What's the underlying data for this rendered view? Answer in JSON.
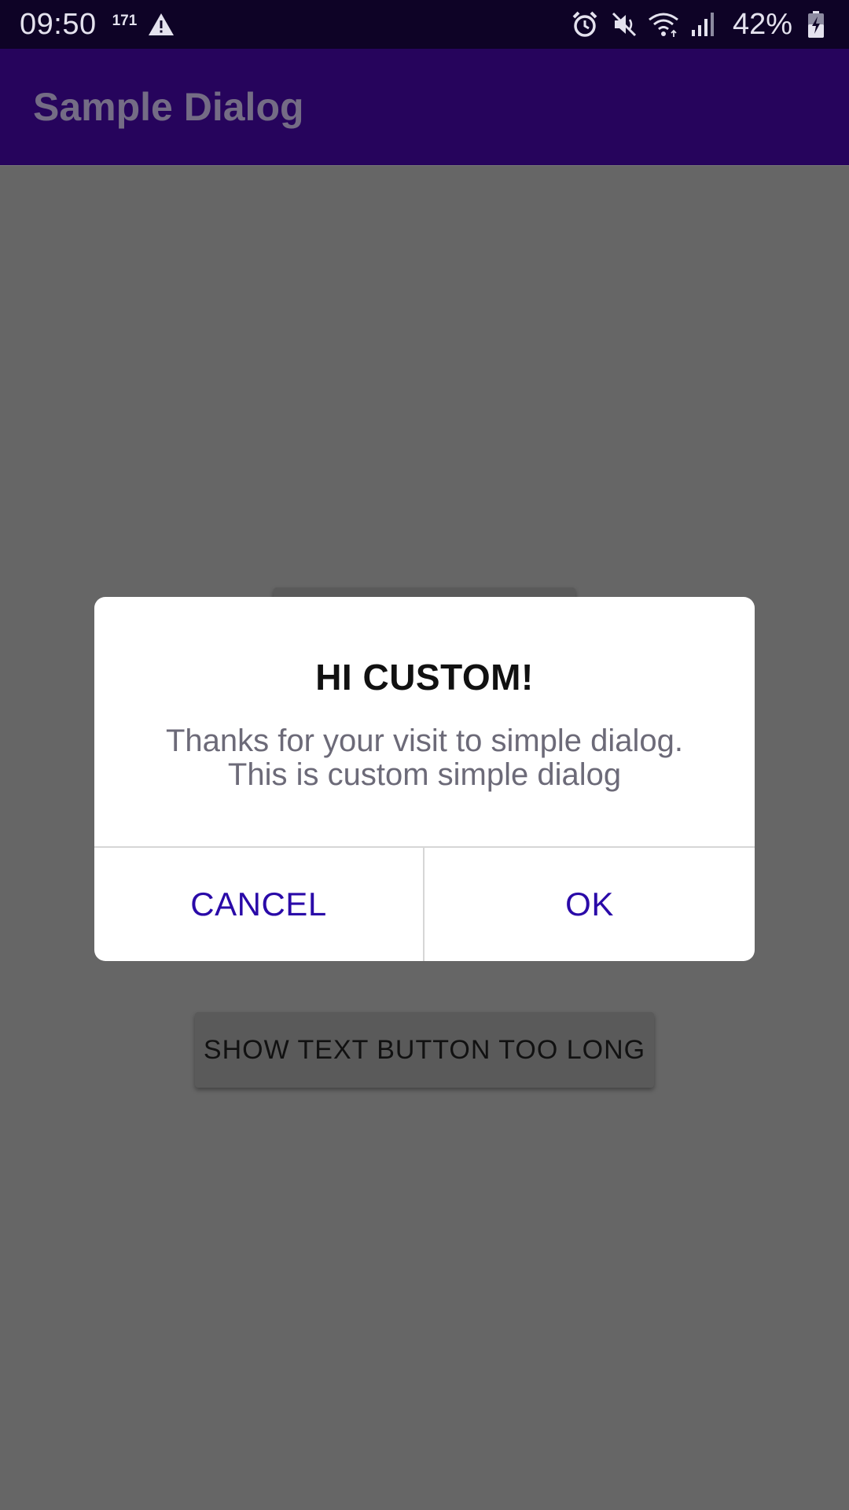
{
  "status_bar": {
    "time": "09:50",
    "notification_count": "171",
    "warning_icon": "warning-icon",
    "icons": [
      "alarm-icon",
      "mute-icon",
      "wifi-icon",
      "signal-icon"
    ],
    "battery_text": "42%",
    "battery_icon": "battery-charging-icon"
  },
  "app_bar": {
    "title": "Sample Dialog"
  },
  "background": {
    "button_long_label": "SHOW TEXT BUTTON TOO LONG"
  },
  "dialog": {
    "title": "HI CUSTOM!",
    "message_line1": "Thanks for your visit to simple dialog.",
    "message_line2": "This is custom simple dialog",
    "cancel_label": "CANCEL",
    "ok_label": "OK"
  },
  "colors": {
    "status_bar_bg": "#0e0326",
    "app_bar_bg": "#26045c",
    "scrim_bg": "#666666",
    "dialog_button_text": "#2a0aa8"
  }
}
